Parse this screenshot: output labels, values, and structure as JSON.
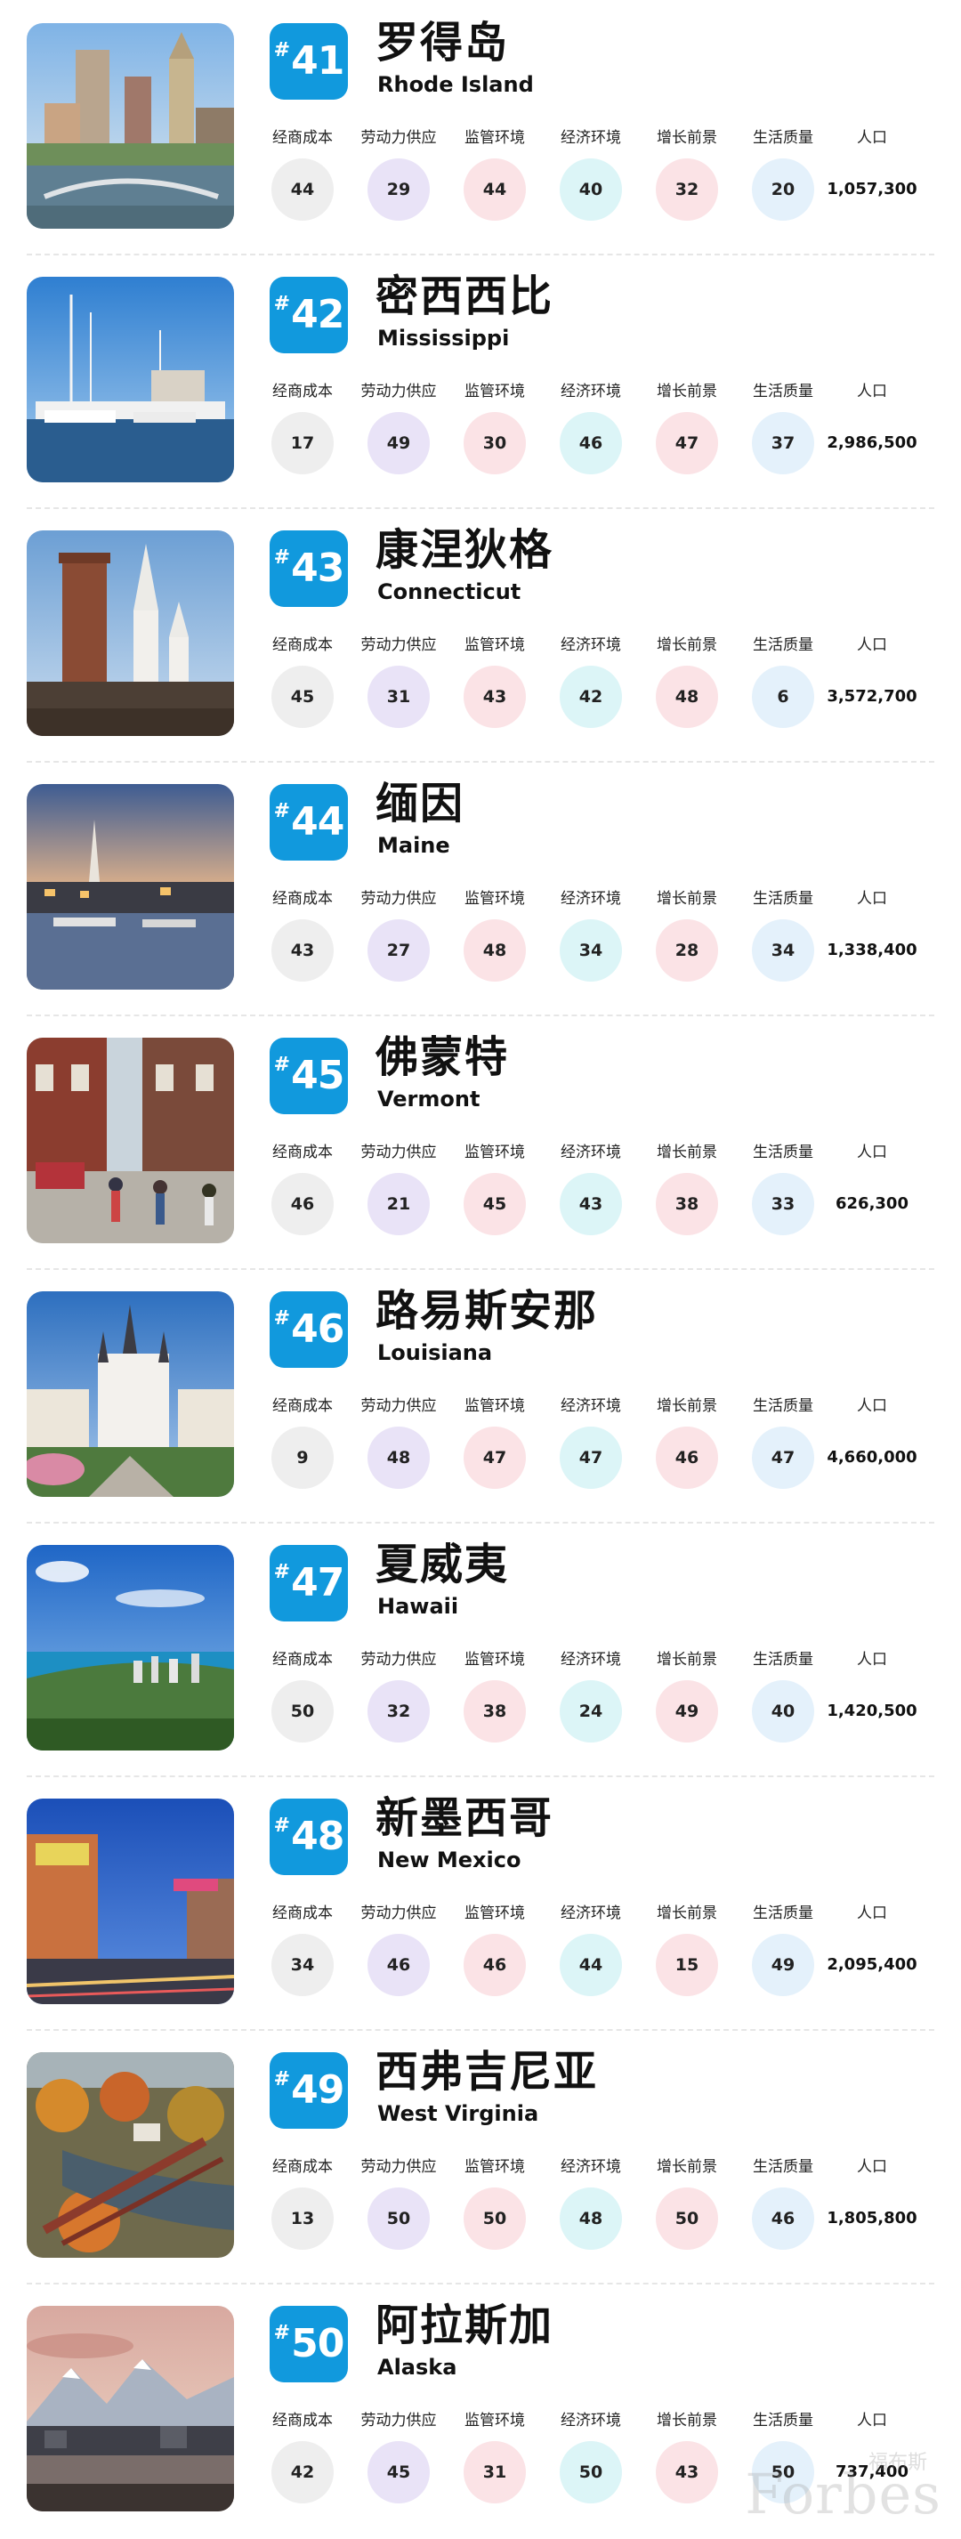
{
  "metric_labels": [
    "经商成本",
    "劳动力供应",
    "监管环境",
    "经济环境",
    "增长前景",
    "生活质量"
  ],
  "population_label": "人口",
  "metric_colors": [
    "#eeeeee",
    "#e9e3f7",
    "#fbe3e6",
    "#dcf5f7",
    "#fbe3e6",
    "#e4f1fb"
  ],
  "rank_prefix": "#",
  "accent_color": "#1199dd",
  "entries": [
    {
      "rank": "41",
      "name_zh": "罗得岛",
      "name_en": "Rhode Island",
      "scores": [
        "44",
        "29",
        "44",
        "40",
        "32",
        "20"
      ],
      "population": "1,057,300",
      "photo": "city-skyline-photo"
    },
    {
      "rank": "42",
      "name_zh": "密西西比",
      "name_en": "Mississippi",
      "scores": [
        "17",
        "49",
        "30",
        "46",
        "47",
        "37"
      ],
      "population": "2,986,500",
      "photo": "harbor-sailboats-photo"
    },
    {
      "rank": "43",
      "name_zh": "康涅狄格",
      "name_en": "Connecticut",
      "scores": [
        "45",
        "31",
        "43",
        "42",
        "48",
        "6"
      ],
      "population": "3,572,700",
      "photo": "church-steeples-photo"
    },
    {
      "rank": "44",
      "name_zh": "缅因",
      "name_en": "Maine",
      "scores": [
        "43",
        "27",
        "48",
        "34",
        "28",
        "34"
      ],
      "population": "1,338,400",
      "photo": "harbor-dusk-photo"
    },
    {
      "rank": "45",
      "name_zh": "佛蒙特",
      "name_en": "Vermont",
      "scores": [
        "46",
        "21",
        "45",
        "43",
        "38",
        "33"
      ],
      "population": "626,300",
      "photo": "town-street-photo"
    },
    {
      "rank": "46",
      "name_zh": "路易斯安那",
      "name_en": "Louisiana",
      "scores": [
        "9",
        "48",
        "47",
        "47",
        "46",
        "47"
      ],
      "population": "4,660,000",
      "photo": "cathedral-photo"
    },
    {
      "rank": "47",
      "name_zh": "夏威夷",
      "name_en": "Hawaii",
      "scores": [
        "50",
        "32",
        "38",
        "24",
        "49",
        "40"
      ],
      "population": "1,420,500",
      "photo": "coastline-photo"
    },
    {
      "rank": "48",
      "name_zh": "新墨西哥",
      "name_en": "New Mexico",
      "scores": [
        "34",
        "46",
        "46",
        "44",
        "15",
        "49"
      ],
      "population": "2,095,400",
      "photo": "neon-street-photo"
    },
    {
      "rank": "49",
      "name_zh": "西弗吉尼亚",
      "name_en": "West Virginia",
      "scores": [
        "13",
        "50",
        "50",
        "48",
        "50",
        "46"
      ],
      "population": "1,805,800",
      "photo": "autumn-bridge-photo"
    },
    {
      "rank": "50",
      "name_zh": "阿拉斯加",
      "name_en": "Alaska",
      "scores": [
        "42",
        "45",
        "31",
        "50",
        "43",
        "50"
      ],
      "population": "737,400",
      "photo": "mountain-waterfront-photo"
    }
  ],
  "watermark": {
    "sub": "福布斯",
    "main": "Forbes"
  }
}
